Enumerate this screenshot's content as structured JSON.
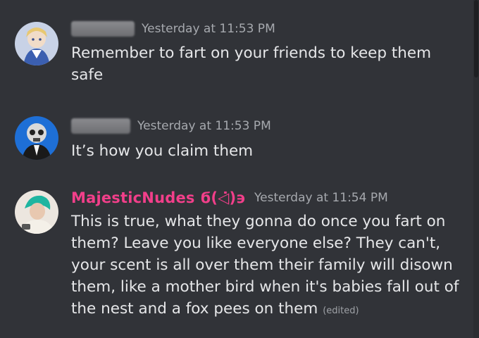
{
  "messages": [
    {
      "author": "",
      "author_redacted": true,
      "timestamp": "Yesterday at 11:53 PM",
      "text": "Remember to fart on your friends to keep them safe",
      "avatar": "anime-character-avatar"
    },
    {
      "author": "",
      "author_redacted": true,
      "timestamp": "Yesterday at 11:53 PM",
      "text": "It’s how you claim them",
      "avatar": "skull-suit-avatar"
    },
    {
      "author": "MajesticNudes ϭ(◁̇)϶",
      "author_redacted": false,
      "timestamp": "Yesterday at 11:54 PM",
      "text": "This is true, what they gonna do once you fart on them? Leave you like everyone else? They can't, your scent is all over them their family will disown them, like a mother bird when it's babies fall out of the nest and a fox pees on them",
      "edited_label": "(edited)",
      "avatar": "green-hair-person-avatar"
    }
  ],
  "colors": {
    "background": "#313338",
    "username_accent": "#f23f8a",
    "timestamp": "#a6a9ae"
  }
}
